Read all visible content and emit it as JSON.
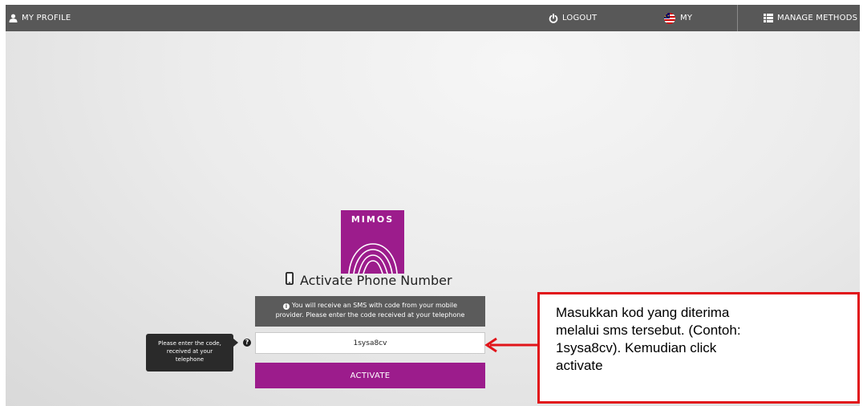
{
  "topbar": {
    "profile_label": "MY PROFILE",
    "logout_label": "LOGOUT",
    "language_label": "MY",
    "manage_methods_label": "MANAGE METHODS"
  },
  "logo": {
    "text": "MIMOS",
    "color": "#9c1c8c"
  },
  "page": {
    "title": "Activate Phone Number",
    "info_line1": "You will receive an SMS with code from your mobile",
    "info_line2": "provider. Please enter the code received at your telephone"
  },
  "form": {
    "tooltip_line1": "Please enter the code,",
    "tooltip_line2": "received at your",
    "tooltip_line3": "telephone",
    "code_value": "1sysa8cv",
    "activate_label": "ACTIVATE"
  },
  "annotation": {
    "line1": "Masukkan kod yang diterima",
    "line2": "melalui sms tersebut. (Contoh:",
    "line3": "1sysa8cv). Kemudian click",
    "line4": "activate"
  },
  "icons": [
    "user-icon",
    "power-icon",
    "malaysia-flag-icon",
    "list-icon",
    "phone-icon",
    "info-icon",
    "help-icon"
  ],
  "colors": {
    "accent": "#9c1c8c",
    "topbar": "#585858",
    "annotation_border": "#e1141a"
  }
}
